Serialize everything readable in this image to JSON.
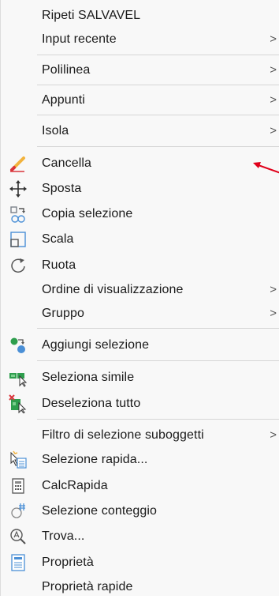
{
  "menu": {
    "items": [
      {
        "label": "Ripeti SALVAVEL",
        "submenu": false,
        "icon": null
      },
      {
        "label": "Input recente",
        "submenu": true,
        "icon": null
      },
      {
        "label": "Polilinea",
        "submenu": true,
        "icon": null
      },
      {
        "label": "Appunti",
        "submenu": true,
        "icon": null
      },
      {
        "label": "Isola",
        "submenu": true,
        "icon": null
      },
      {
        "label": "Cancella",
        "submenu": false,
        "icon": "eraser-icon"
      },
      {
        "label": "Sposta",
        "submenu": false,
        "icon": "move-arrows-icon"
      },
      {
        "label": "Copia selezione",
        "submenu": false,
        "icon": "copy-selection-icon"
      },
      {
        "label": "Scala",
        "submenu": false,
        "icon": "scale-icon"
      },
      {
        "label": "Ruota",
        "submenu": false,
        "icon": "rotate-icon"
      },
      {
        "label": "Ordine di visualizzazione",
        "submenu": true,
        "icon": null
      },
      {
        "label": "Gruppo",
        "submenu": true,
        "icon": null
      },
      {
        "label": "Aggiungi selezione",
        "submenu": false,
        "icon": "add-selection-icon"
      },
      {
        "label": "Seleziona simile",
        "submenu": false,
        "icon": "select-similar-icon"
      },
      {
        "label": "Deseleziona tutto",
        "submenu": false,
        "icon": "deselect-all-icon"
      },
      {
        "label": "Filtro di selezione suboggetti",
        "submenu": true,
        "icon": null
      },
      {
        "label": "Selezione rapida...",
        "submenu": false,
        "icon": "quick-select-icon"
      },
      {
        "label": "CalcRapida",
        "submenu": false,
        "icon": "calculator-icon"
      },
      {
        "label": "Selezione conteggio",
        "submenu": false,
        "icon": "count-selection-icon"
      },
      {
        "label": "Trova...",
        "submenu": false,
        "icon": "find-icon"
      },
      {
        "label": "Proprietà",
        "submenu": false,
        "icon": "properties-icon"
      },
      {
        "label": "Proprietà rapide",
        "submenu": false,
        "icon": null
      }
    ],
    "submenu_glyph": ">"
  },
  "colors": {
    "menu_bg": "#f8f8f8",
    "separator": "#d6d6d6",
    "annotation_arrow": "#e0001a"
  }
}
